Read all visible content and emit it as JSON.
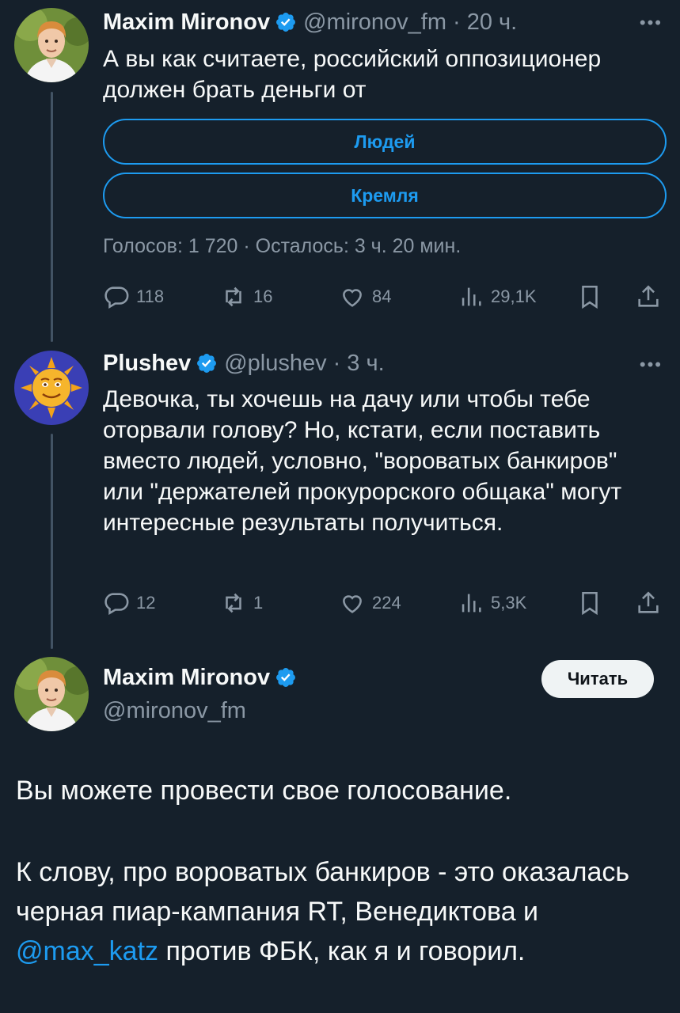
{
  "tweet1": {
    "name": "Maxim Mironov",
    "handle": "@mironov_fm",
    "time": "20 ч.",
    "text": "А вы как считаете, российский оппозиционер должен брать деньги от",
    "poll": {
      "options": [
        "Людей",
        "Кремля"
      ],
      "meta": "Голосов: 1 720 · Осталось: 3 ч. 20 мин."
    },
    "stats": {
      "replies": "118",
      "retweets": "16",
      "likes": "84",
      "views": "29,1K"
    }
  },
  "tweet2": {
    "name": "Plushev",
    "handle": "@plushev",
    "time": "3 ч.",
    "text": "Девочка, ты хочешь на дачу или чтобы тебе оторвали голову? Но, кстати, если поставить вместо людей, условно, \"вороватых банкиров\" или \"держателей прокурорского общака\" могут интересные результаты получиться.",
    "stats": {
      "replies": "12",
      "retweets": "1",
      "likes": "224",
      "views": "5,3K"
    }
  },
  "main": {
    "name": "Maxim Mironov",
    "handle": "@mironov_fm",
    "follow_label": "Читать",
    "para1": "Вы можете провести свое голосование.",
    "para2_before": "К слову, про вороватых банкиров - это оказалась черная пиар-кампания RT, Венедиктова и ",
    "para2_mention": "@max_katz",
    "para2_after": " против ФБК, как я и говорил."
  },
  "ui": {
    "dot": "·",
    "more": "•••"
  },
  "colors": {
    "background": "#15202b",
    "accent": "#1d9bf0",
    "muted": "#8b98a5",
    "verified": "#1d9bf0"
  }
}
